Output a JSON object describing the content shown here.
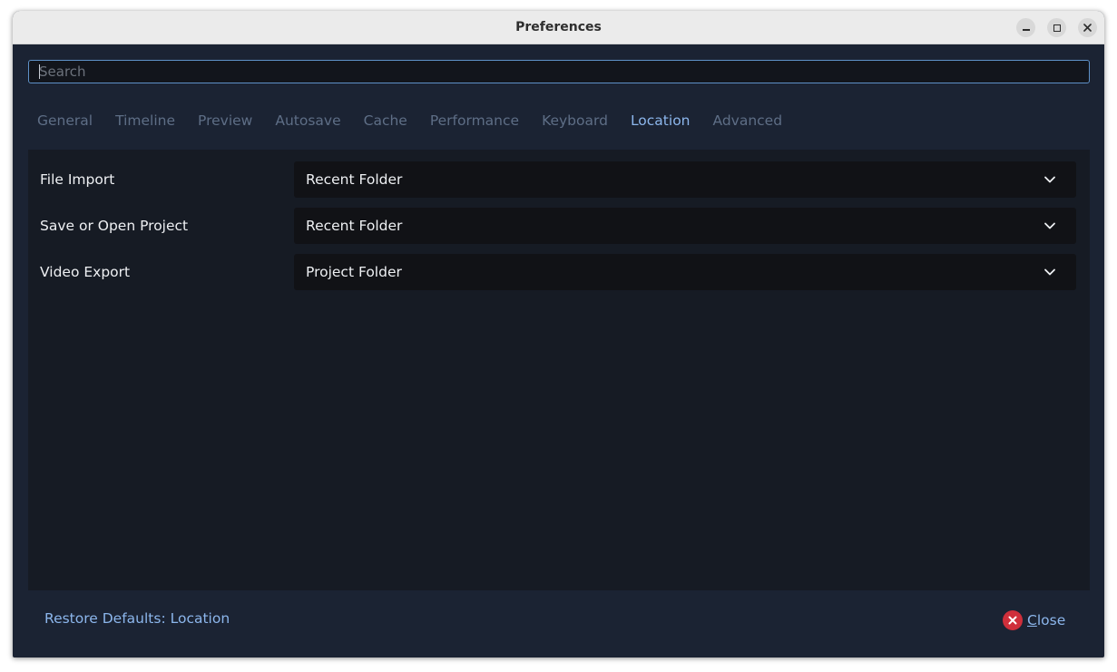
{
  "window": {
    "title": "Preferences"
  },
  "search": {
    "placeholder": "Search",
    "value": ""
  },
  "tabs": [
    {
      "label": "General",
      "active": false
    },
    {
      "label": "Timeline",
      "active": false
    },
    {
      "label": "Preview",
      "active": false
    },
    {
      "label": "Autosave",
      "active": false
    },
    {
      "label": "Cache",
      "active": false
    },
    {
      "label": "Performance",
      "active": false
    },
    {
      "label": "Keyboard",
      "active": false
    },
    {
      "label": "Location",
      "active": true
    },
    {
      "label": "Advanced",
      "active": false
    }
  ],
  "settings": [
    {
      "label": "File Import",
      "value": "Recent Folder"
    },
    {
      "label": "Save or Open Project",
      "value": "Recent Folder"
    },
    {
      "label": "Video Export",
      "value": "Project Folder"
    }
  ],
  "footer": {
    "restore_label": "Restore Defaults: Location",
    "close_mnemonic": "C",
    "close_rest": "lose"
  },
  "icons": {
    "minimize": "minimize-icon",
    "maximize": "maximize-icon",
    "close_window": "close-window-icon",
    "chevron": "chevron-down-icon",
    "close_button": "close-circle-icon"
  },
  "colors": {
    "accent": "#8cb6ec",
    "background": "#1b2333",
    "panel": "#161b24",
    "combo": "#111216",
    "close_icon": "#cf2f3b",
    "inactive_tab": "#5e6e86"
  }
}
